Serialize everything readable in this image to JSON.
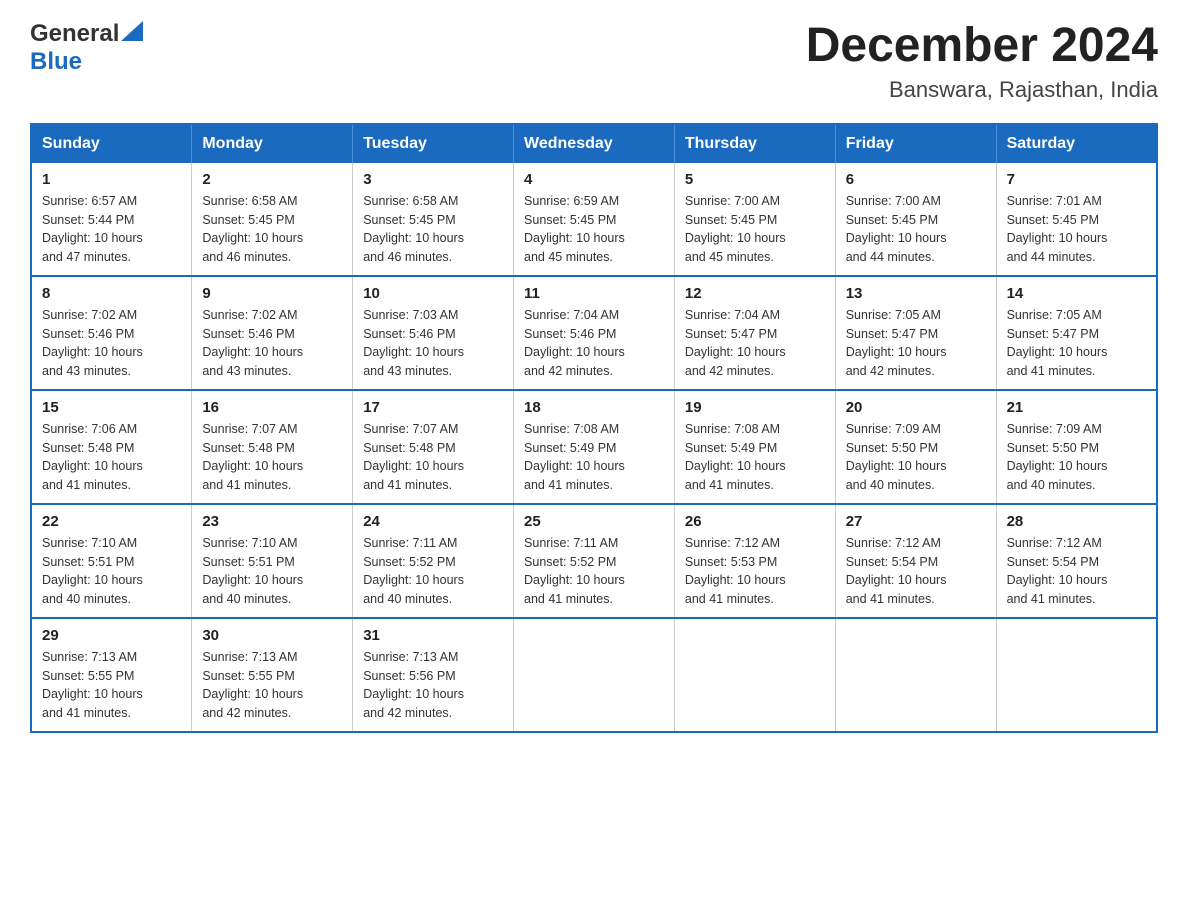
{
  "header": {
    "logo_general": "General",
    "logo_blue": "Blue",
    "month": "December 2024",
    "location": "Banswara, Rajasthan, India"
  },
  "weekdays": [
    "Sunday",
    "Monday",
    "Tuesday",
    "Wednesday",
    "Thursday",
    "Friday",
    "Saturday"
  ],
  "weeks": [
    [
      {
        "day": "1",
        "sunrise": "6:57 AM",
        "sunset": "5:44 PM",
        "daylight": "10 hours and 47 minutes."
      },
      {
        "day": "2",
        "sunrise": "6:58 AM",
        "sunset": "5:45 PM",
        "daylight": "10 hours and 46 minutes."
      },
      {
        "day": "3",
        "sunrise": "6:58 AM",
        "sunset": "5:45 PM",
        "daylight": "10 hours and 46 minutes."
      },
      {
        "day": "4",
        "sunrise": "6:59 AM",
        "sunset": "5:45 PM",
        "daylight": "10 hours and 45 minutes."
      },
      {
        "day": "5",
        "sunrise": "7:00 AM",
        "sunset": "5:45 PM",
        "daylight": "10 hours and 45 minutes."
      },
      {
        "day": "6",
        "sunrise": "7:00 AM",
        "sunset": "5:45 PM",
        "daylight": "10 hours and 44 minutes."
      },
      {
        "day": "7",
        "sunrise": "7:01 AM",
        "sunset": "5:45 PM",
        "daylight": "10 hours and 44 minutes."
      }
    ],
    [
      {
        "day": "8",
        "sunrise": "7:02 AM",
        "sunset": "5:46 PM",
        "daylight": "10 hours and 43 minutes."
      },
      {
        "day": "9",
        "sunrise": "7:02 AM",
        "sunset": "5:46 PM",
        "daylight": "10 hours and 43 minutes."
      },
      {
        "day": "10",
        "sunrise": "7:03 AM",
        "sunset": "5:46 PM",
        "daylight": "10 hours and 43 minutes."
      },
      {
        "day": "11",
        "sunrise": "7:04 AM",
        "sunset": "5:46 PM",
        "daylight": "10 hours and 42 minutes."
      },
      {
        "day": "12",
        "sunrise": "7:04 AM",
        "sunset": "5:47 PM",
        "daylight": "10 hours and 42 minutes."
      },
      {
        "day": "13",
        "sunrise": "7:05 AM",
        "sunset": "5:47 PM",
        "daylight": "10 hours and 42 minutes."
      },
      {
        "day": "14",
        "sunrise": "7:05 AM",
        "sunset": "5:47 PM",
        "daylight": "10 hours and 41 minutes."
      }
    ],
    [
      {
        "day": "15",
        "sunrise": "7:06 AM",
        "sunset": "5:48 PM",
        "daylight": "10 hours and 41 minutes."
      },
      {
        "day": "16",
        "sunrise": "7:07 AM",
        "sunset": "5:48 PM",
        "daylight": "10 hours and 41 minutes."
      },
      {
        "day": "17",
        "sunrise": "7:07 AM",
        "sunset": "5:48 PM",
        "daylight": "10 hours and 41 minutes."
      },
      {
        "day": "18",
        "sunrise": "7:08 AM",
        "sunset": "5:49 PM",
        "daylight": "10 hours and 41 minutes."
      },
      {
        "day": "19",
        "sunrise": "7:08 AM",
        "sunset": "5:49 PM",
        "daylight": "10 hours and 41 minutes."
      },
      {
        "day": "20",
        "sunrise": "7:09 AM",
        "sunset": "5:50 PM",
        "daylight": "10 hours and 40 minutes."
      },
      {
        "day": "21",
        "sunrise": "7:09 AM",
        "sunset": "5:50 PM",
        "daylight": "10 hours and 40 minutes."
      }
    ],
    [
      {
        "day": "22",
        "sunrise": "7:10 AM",
        "sunset": "5:51 PM",
        "daylight": "10 hours and 40 minutes."
      },
      {
        "day": "23",
        "sunrise": "7:10 AM",
        "sunset": "5:51 PM",
        "daylight": "10 hours and 40 minutes."
      },
      {
        "day": "24",
        "sunrise": "7:11 AM",
        "sunset": "5:52 PM",
        "daylight": "10 hours and 40 minutes."
      },
      {
        "day": "25",
        "sunrise": "7:11 AM",
        "sunset": "5:52 PM",
        "daylight": "10 hours and 41 minutes."
      },
      {
        "day": "26",
        "sunrise": "7:12 AM",
        "sunset": "5:53 PM",
        "daylight": "10 hours and 41 minutes."
      },
      {
        "day": "27",
        "sunrise": "7:12 AM",
        "sunset": "5:54 PM",
        "daylight": "10 hours and 41 minutes."
      },
      {
        "day": "28",
        "sunrise": "7:12 AM",
        "sunset": "5:54 PM",
        "daylight": "10 hours and 41 minutes."
      }
    ],
    [
      {
        "day": "29",
        "sunrise": "7:13 AM",
        "sunset": "5:55 PM",
        "daylight": "10 hours and 41 minutes."
      },
      {
        "day": "30",
        "sunrise": "7:13 AM",
        "sunset": "5:55 PM",
        "daylight": "10 hours and 42 minutes."
      },
      {
        "day": "31",
        "sunrise": "7:13 AM",
        "sunset": "5:56 PM",
        "daylight": "10 hours and 42 minutes."
      },
      null,
      null,
      null,
      null
    ]
  ],
  "labels": {
    "sunrise": "Sunrise:",
    "sunset": "Sunset:",
    "daylight": "Daylight:"
  }
}
